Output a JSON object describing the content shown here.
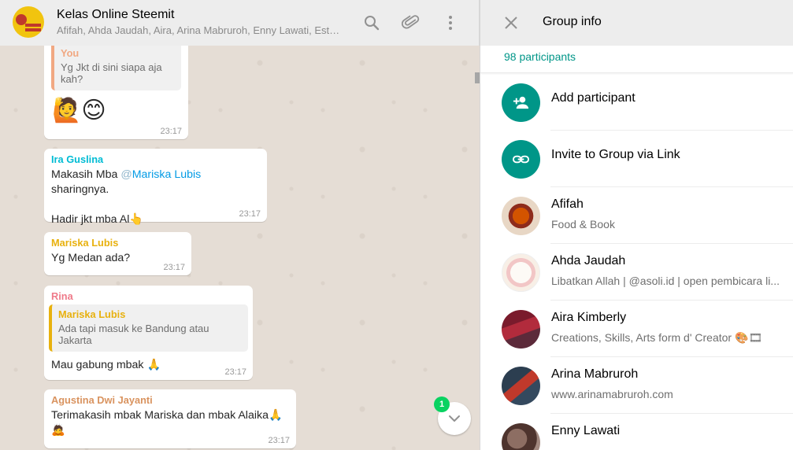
{
  "chat": {
    "title": "Kelas Online Steemit",
    "members": "Afifah, Ahda Jaudah, Aira, Arina Mabruroh, Enny Lawati, Esti, ...",
    "messages": [
      {
        "quote_name": "You",
        "quote_text": "Yg Jkt di sini siapa aja kah?",
        "text": "🙋😊",
        "time": "23:17"
      },
      {
        "sender": "Ira Guslina",
        "text_before": "Makasih Mba ",
        "mention_at": "@",
        "mention": "Mariska Lubis",
        "text_after": " sharingnya.",
        "text2": "Hadir jkt mba Al👆",
        "time": "23:17"
      },
      {
        "sender": "Mariska Lubis",
        "text": "Yg Medan ada?",
        "time": "23:17"
      },
      {
        "sender": "Rina",
        "quote_name": "Mariska Lubis",
        "quote_text": "Ada tapi masuk ke Bandung atau Jakarta",
        "text": "Mau gabung mbak 🙏",
        "time": "23:17"
      },
      {
        "sender": "Agustina Dwi Jayanti",
        "text": "Terimakasih mbak Mariska dan mbak Alaika🙏",
        "text2": "🙇",
        "time": "23:17"
      }
    ],
    "unread_count": "1",
    "colors": {
      "ira": "#00bcd4",
      "mariska": "#e8b10e",
      "rina": "#ef7b8a",
      "agustina": "#d9935f",
      "you": "#f1a882"
    }
  },
  "info": {
    "title": "Group info",
    "participant_count": "98 participants",
    "actions": [
      {
        "label": "Add participant",
        "icon": "add-person-icon"
      },
      {
        "label": "Invite to Group via Link",
        "icon": "link-icon"
      }
    ],
    "participants": [
      {
        "name": "Afifah",
        "status": "Food & Book"
      },
      {
        "name": "Ahda Jaudah",
        "status": "Libatkan Allah | @asoli.id | open pembicara li..."
      },
      {
        "name": "Aira Kimberly",
        "status": "Creations, Skills, Arts form d' Creator 🎨🎞"
      },
      {
        "name": "Arina Mabruroh",
        "status": "www.arinamabruroh.com"
      },
      {
        "name": "Enny Lawati",
        "status": ""
      }
    ],
    "accent_color": "#009688"
  }
}
